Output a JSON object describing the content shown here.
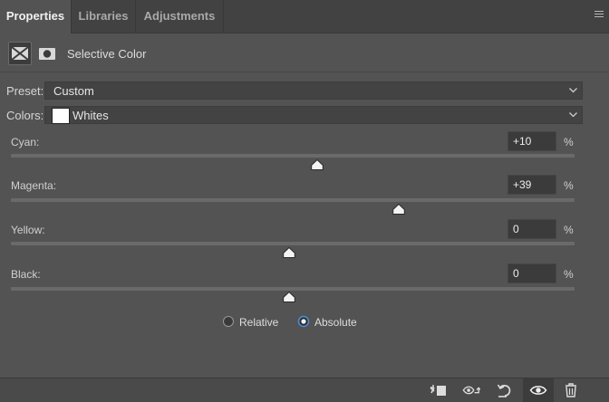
{
  "tabs": [
    {
      "label": "Properties",
      "active": true
    },
    {
      "label": "Libraries",
      "active": false
    },
    {
      "label": "Adjustments",
      "active": false
    }
  ],
  "header": {
    "title": "Selective Color",
    "adjustment_icon": "adjustment-layer-icon",
    "mask_icon": "layer-mask-icon"
  },
  "preset": {
    "label": "Preset:",
    "value": "Custom"
  },
  "colors": {
    "label": "Colors:",
    "value": "Whites",
    "swatch_color": "#ffffff"
  },
  "sliders": [
    {
      "label": "Cyan:",
      "value": "+10",
      "unit": "%",
      "numeric": 10
    },
    {
      "label": "Magenta:",
      "value": "+39",
      "unit": "%",
      "numeric": 39
    },
    {
      "label": "Yellow:",
      "value": "0",
      "unit": "%",
      "numeric": 0
    },
    {
      "label": "Black:",
      "value": "0",
      "unit": "%",
      "numeric": 0
    }
  ],
  "method": {
    "options": [
      {
        "label": "Relative",
        "selected": false
      },
      {
        "label": "Absolute",
        "selected": true
      }
    ]
  },
  "bottom_icons": [
    "clip-to-layer-icon",
    "view-previous-state-icon",
    "reset-icon",
    "visibility-eye-icon",
    "trash-icon"
  ],
  "colors_theme": {
    "panel": "#535353",
    "accent": "#4a90d9"
  }
}
